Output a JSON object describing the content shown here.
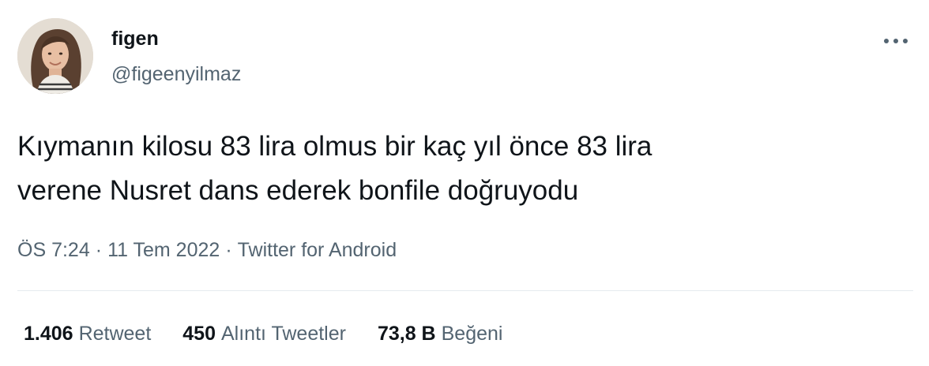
{
  "author": {
    "display_name": "figen",
    "handle": "@figeenyilmaz",
    "avatar_icon": "profile-photo"
  },
  "menu": {
    "icon": "more-dots-icon",
    "glyph": "•••"
  },
  "tweet": {
    "lines": [
      "Kıymanın kilosu 83 lira olmus bir kaç yıl önce 83 lira",
      "verene Nusret dans ederek bonfile doğruyodu"
    ],
    "time": "ÖS 7:24",
    "date": "11 Tem 2022",
    "source": "Twitter for Android",
    "separator": "·"
  },
  "stats": [
    {
      "count": "1.406",
      "label": "Retweet"
    },
    {
      "count": "450",
      "label": "Alıntı Tweetler"
    },
    {
      "count": "73,8 B",
      "label": "Beğeni"
    }
  ],
  "colors": {
    "text": "#0f1419",
    "secondary": "#536471",
    "divider": "#e6ebef"
  }
}
